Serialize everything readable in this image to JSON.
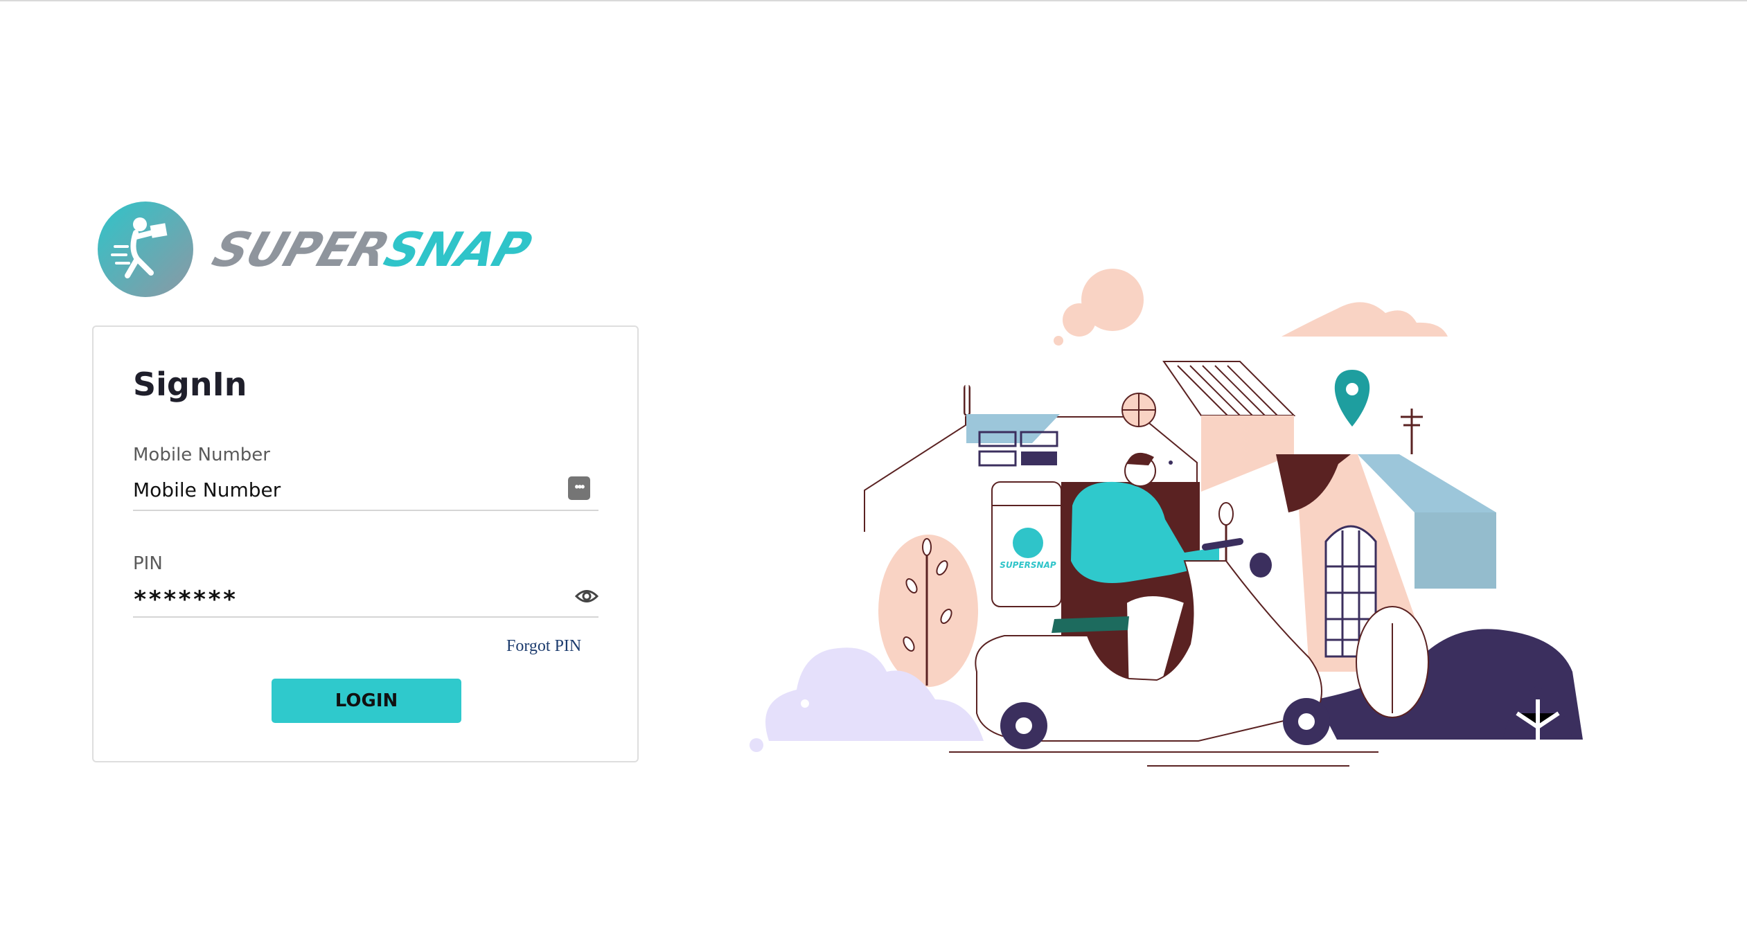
{
  "brand": {
    "logo_icon": "delivery-person-logo-icon",
    "wordmark_part1": "SUPER",
    "wordmark_part2": "SNAP",
    "colors": {
      "teal": "#2fc4c9",
      "grey": "#8f959d"
    }
  },
  "signin": {
    "title": "SignIn",
    "mobile": {
      "label": "Mobile Number",
      "value": "Mobile Number",
      "icon": "autofill-key-icon"
    },
    "pin": {
      "label": "PIN",
      "value": "*******",
      "icon": "eye-icon"
    },
    "forgot_label": "Forgot PIN",
    "login_label": "LOGIN"
  },
  "illustration": {
    "description_icon": "delivery-scooter-illustration",
    "badge_text": "SUPERSNAP",
    "colors": {
      "teal": "#2fc9cc",
      "navy": "#3b2f5e",
      "peach": "#f9d3c4",
      "lavender": "#e5e0fb",
      "brown": "#5a2222",
      "sky": "#9cc6da"
    }
  }
}
